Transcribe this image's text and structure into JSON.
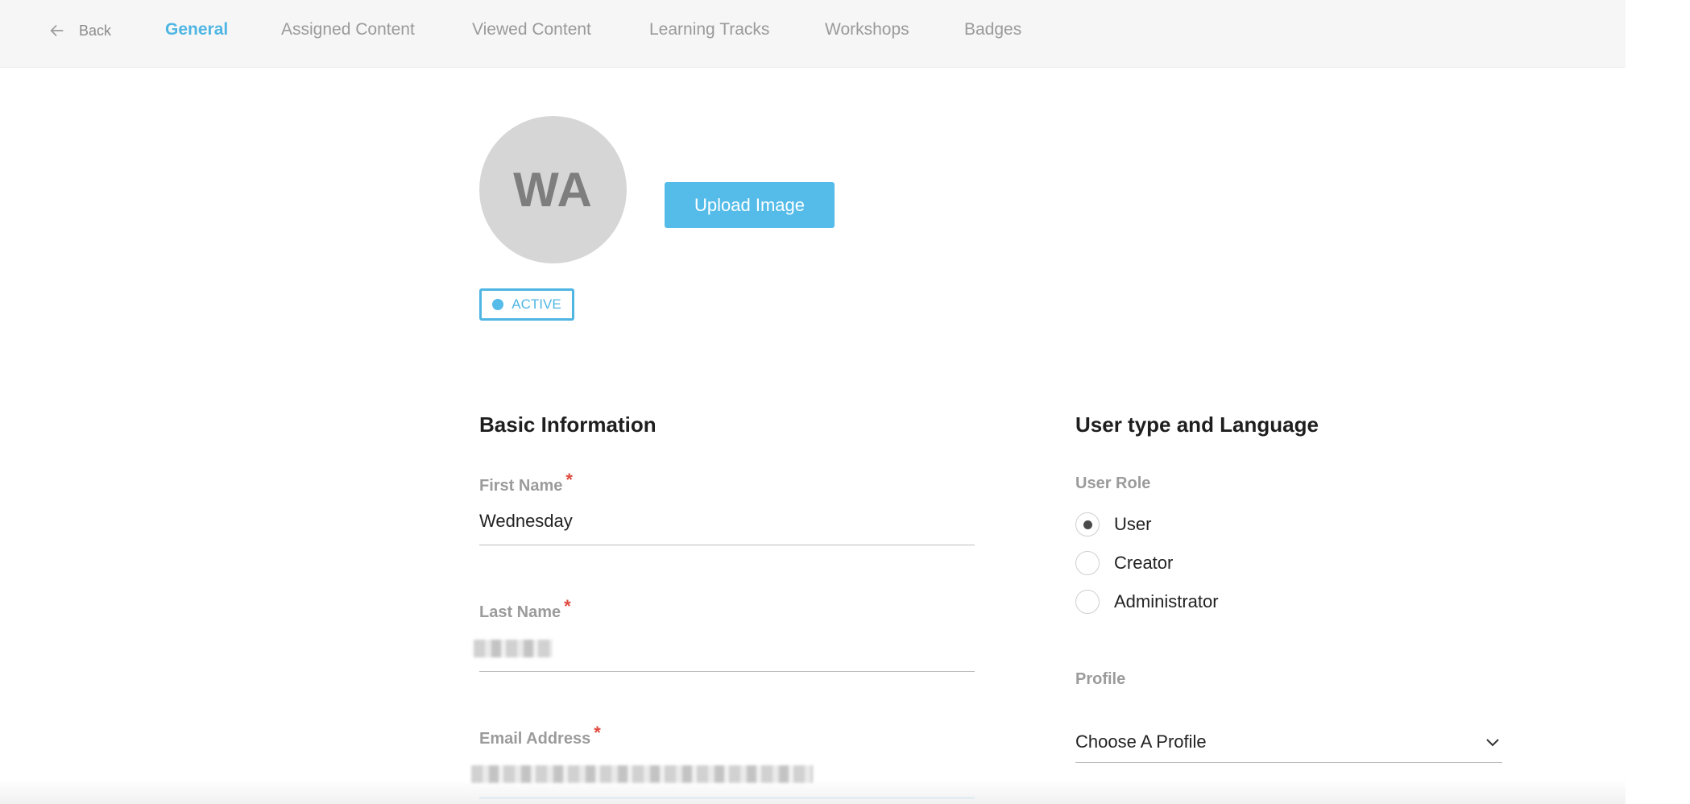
{
  "nav": {
    "back_label": "Back",
    "tabs": [
      {
        "label": "General",
        "active": true
      },
      {
        "label": "Assigned Content",
        "active": false
      },
      {
        "label": "Viewed Content",
        "active": false
      },
      {
        "label": "Learning Tracks",
        "active": false
      },
      {
        "label": "Workshops",
        "active": false
      },
      {
        "label": "Badges",
        "active": false
      }
    ]
  },
  "profile": {
    "initials": "WA",
    "upload_label": "Upload Image",
    "status": "ACTIVE"
  },
  "basic_info": {
    "title": "Basic Information",
    "first_name": {
      "label": "First Name",
      "value": "Wednesday"
    },
    "last_name": {
      "label": "Last Name"
    },
    "email": {
      "label": "Email Address"
    }
  },
  "user_type": {
    "title": "User type and Language",
    "role_label": "User Role",
    "roles": [
      {
        "label": "User",
        "selected": true
      },
      {
        "label": "Creator",
        "selected": false
      },
      {
        "label": "Administrator",
        "selected": false
      }
    ],
    "profile_label": "Profile",
    "profile_placeholder": "Choose A Profile"
  },
  "colors": {
    "accent": "#4fb6e3",
    "button": "#55bce9",
    "required": "#e04a3f"
  },
  "icons": {
    "back": "arrow-left-icon",
    "dropdown": "chevron-down-icon"
  }
}
